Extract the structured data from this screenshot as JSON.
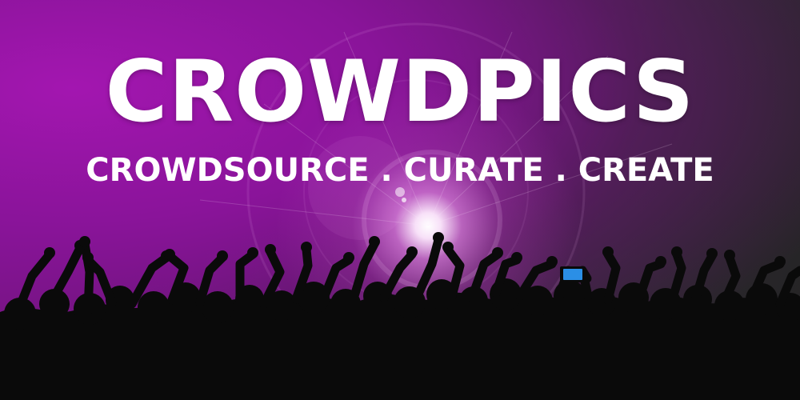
{
  "banner": {
    "title": "CROWDPICS",
    "tagline": "CROWDSOURCE . CURATE . CREATE"
  },
  "colors": {
    "background_purple": "#8d139f",
    "background_dark": "#242424",
    "text": "#ffffff",
    "silhouette": "#0a0a0a",
    "phone_screen": "#2b8fe6"
  }
}
